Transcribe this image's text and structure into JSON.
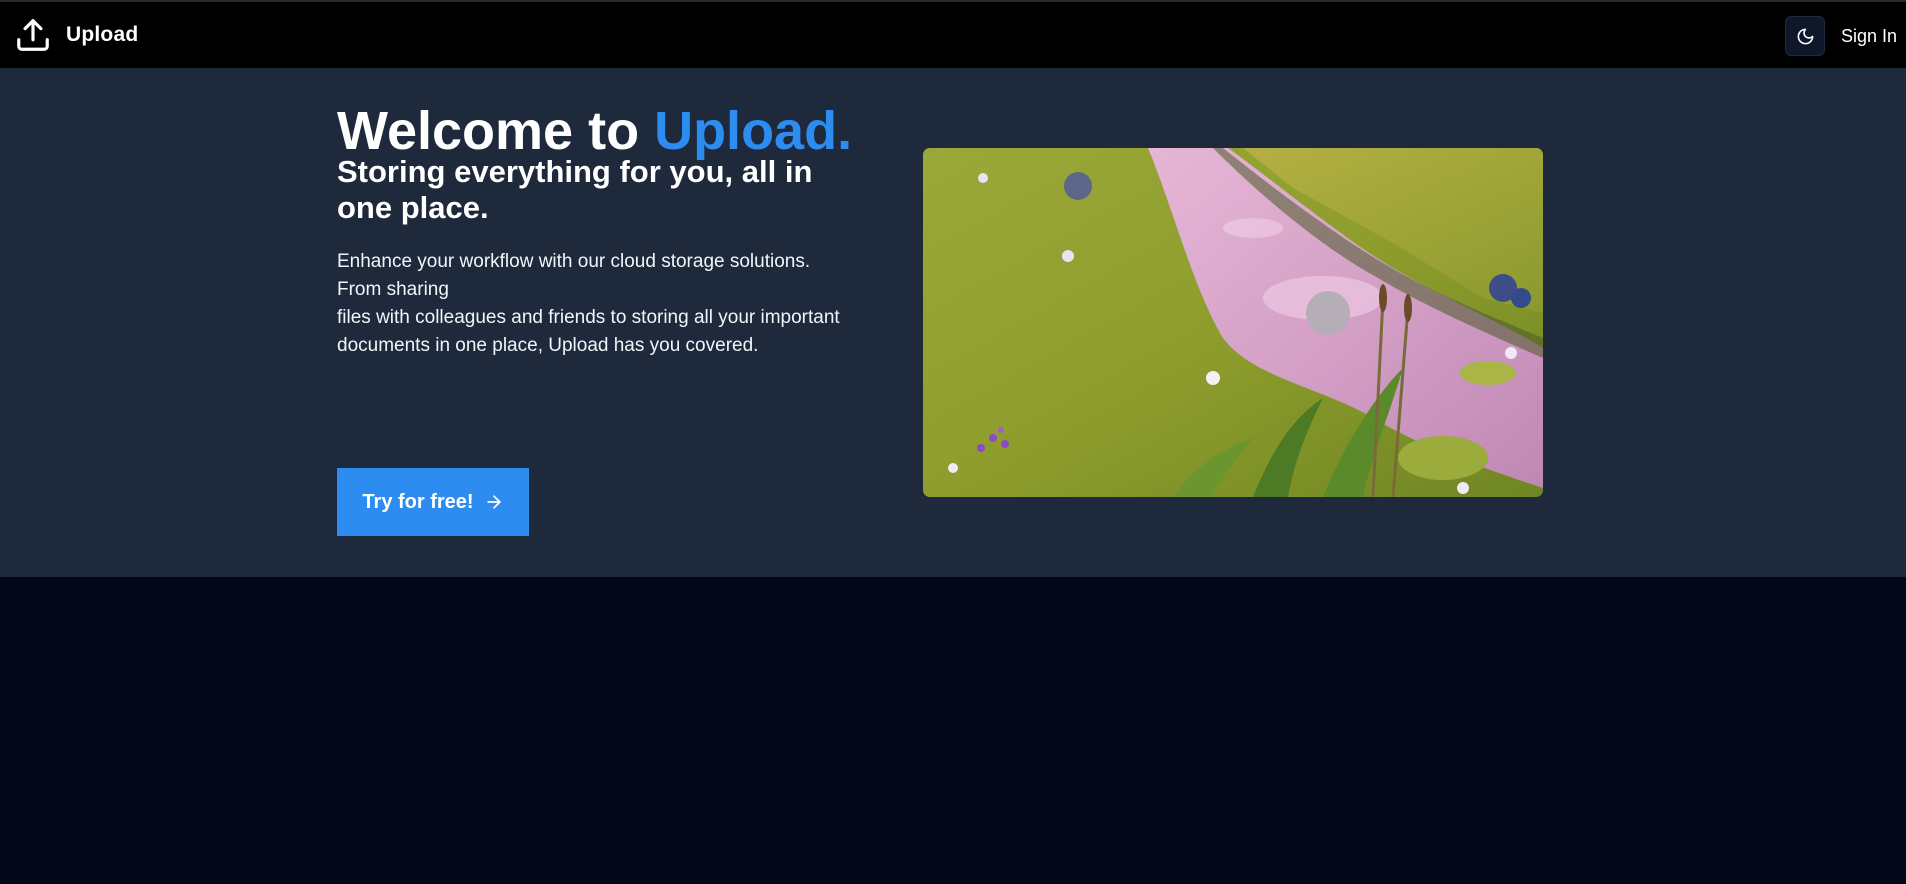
{
  "navbar": {
    "brand_name": "Upload",
    "brand_icon": "upload-icon",
    "theme_toggle_icon": "moon-icon",
    "sign_in_label": "Sign In"
  },
  "hero": {
    "title_prefix": "Welcome to ",
    "title_accent": "Upload.",
    "subtitle": "Storing everything for you, all in one place.",
    "description_lines": [
      "Enhance your workflow with our cloud storage solutions. From sharing",
      "files with colleagues and friends to storing all your important",
      "documents in one place, Upload has you covered."
    ],
    "cta_label": "Try for free!",
    "cta_icon": "arrow-right-icon",
    "image_subject": "stylized meadow with a pink stream, grass, reeds and wildflowers"
  },
  "colors": {
    "navbar_bg": "#000000",
    "hero_bg": "#1e293b",
    "page_bg": "#020817",
    "accent": "#2d8cf0",
    "text": "#ffffff"
  }
}
